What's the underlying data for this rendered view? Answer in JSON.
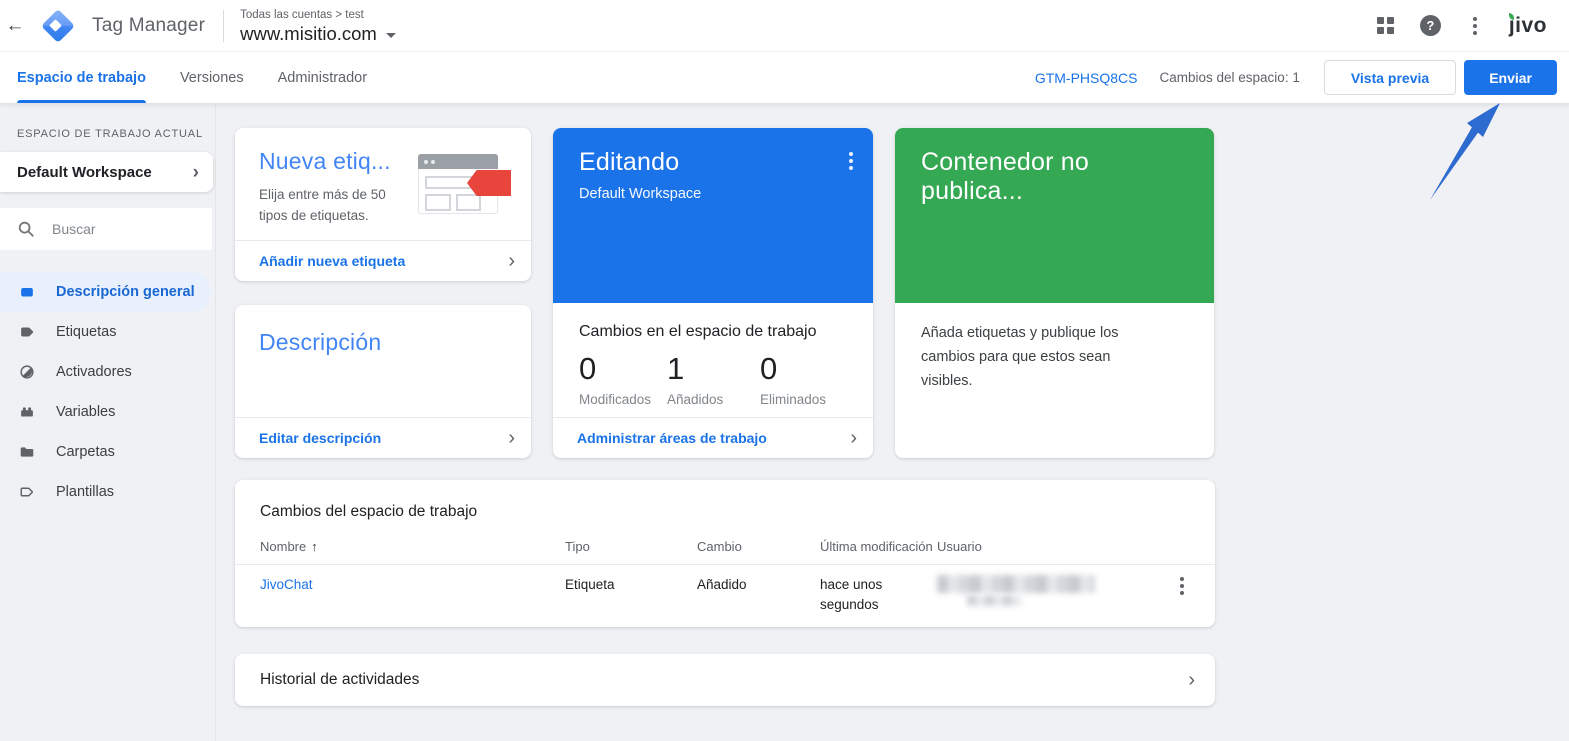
{
  "header": {
    "app_title": "Tag Manager",
    "breadcrumb": "Todas las cuentas > test",
    "container_domain": "www.misitio.com",
    "help_glyph": "?",
    "partner_logo": "jivo"
  },
  "tabbar": {
    "tabs": [
      {
        "label": "Espacio de trabajo"
      },
      {
        "label": "Versiones"
      },
      {
        "label": "Administrador"
      }
    ],
    "container_id": "GTM-PHSQ8CS",
    "changes_count": "Cambios del espacio: 1",
    "preview_button": "Vista previa",
    "submit_button": "Enviar"
  },
  "sidebar": {
    "section_label": "ESPACIO DE TRABAJO ACTUAL",
    "workspace_name": "Default Workspace",
    "search_placeholder": "Buscar",
    "items": [
      {
        "label": "Descripción general"
      },
      {
        "label": "Etiquetas"
      },
      {
        "label": "Activadores"
      },
      {
        "label": "Variables"
      },
      {
        "label": "Carpetas"
      },
      {
        "label": "Plantillas"
      }
    ]
  },
  "cards": {
    "new_tag": {
      "title": "Nueva etiq...",
      "description": "Elija entre más de 50 tipos de etiquetas.",
      "footer_link": "Añadir nueva etiqueta"
    },
    "description": {
      "title": "Descripción",
      "footer_link": "Editar descripción"
    },
    "editing": {
      "title": "Editando",
      "subtitle": "Default Workspace",
      "section_title": "Cambios en el espacio de trabajo",
      "stats": [
        {
          "value": "0",
          "label": "Modificados"
        },
        {
          "value": "1",
          "label": "Añadidos"
        },
        {
          "value": "0",
          "label": "Eliminados"
        }
      ],
      "footer_link": "Administrar áreas de trabajo"
    },
    "unpublished": {
      "title": "Contenedor no publica...",
      "body": "Añada etiquetas y publique los cambios para que estos sean visibles."
    }
  },
  "changes_table": {
    "title": "Cambios del espacio de trabajo",
    "columns": [
      "Nombre",
      "Tipo",
      "Cambio",
      "Última modificación",
      "Usuario"
    ],
    "rows": [
      {
        "name": "JivoChat",
        "type": "Etiqueta",
        "change": "Añadido",
        "modified": "hace unos segundos"
      }
    ]
  },
  "activity": {
    "title": "Historial de actividades"
  },
  "colors": {
    "accent_blue": "#1a73e8",
    "banner_green": "#34a853",
    "tag_red": "#e8453c",
    "active_item_bg": "#e8f0fe"
  }
}
